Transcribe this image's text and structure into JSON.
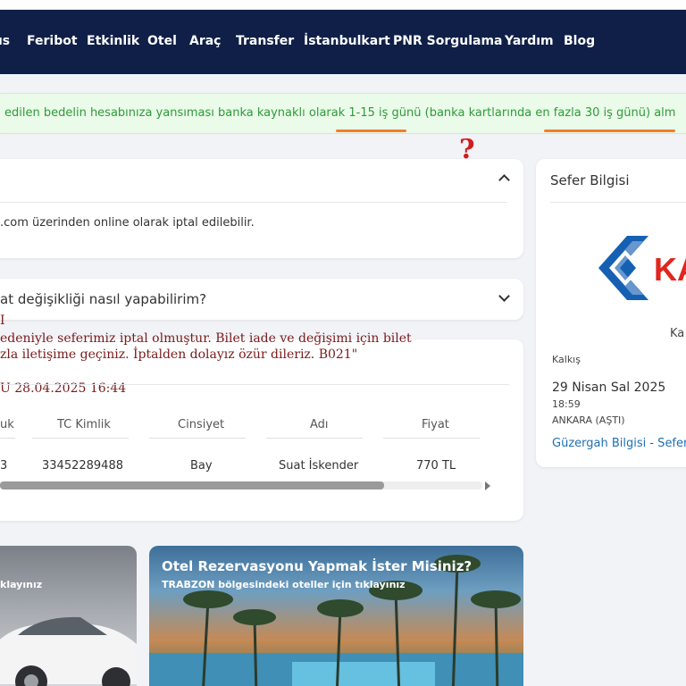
{
  "nav": {
    "items": [
      "ıs",
      "Feribot",
      "Etkinlik",
      "Otel",
      "Araç",
      "Transfer",
      "İstanbulkart",
      "PNR Sorgulama",
      "Yardım",
      "Blog"
    ]
  },
  "notice": {
    "text": "edilen bedelin hesabınıza yansıması banka kaynaklı olarak 1-15 iş günü (banka kartlarında en fazla 30 iş günü) alm"
  },
  "overlay": {
    "question_mark": "?"
  },
  "faq": {
    "card1_text": ".com üzerinden online olarak iptal edilebilir.",
    "card2_question": "at değişikliği nasıl yapabilirim?"
  },
  "cancel_message": {
    "line0": "I",
    "line1": "edeniyle seferimiz iptal olmuştur.  Bilet iade ve değişimi için bilet",
    "line2": "zla iletişime geçiniz.  İptalden dolayız özür dileriz.  B021\"",
    "line3": "U  28.04.2025 16:44"
  },
  "ticket_table": {
    "headers": [
      "uk",
      "TC Kimlik",
      "Cinsiyet",
      "Adı",
      "Fiyat"
    ],
    "row": [
      "3",
      "33452289488",
      "Bay",
      "Suat İskender",
      "770 TL"
    ]
  },
  "sidebar": {
    "title": "Sefer Bilgisi",
    "company_partial": "Ka",
    "departure_label": "Kalkış",
    "date": "29 Nisan Sal 2025",
    "time": "18:59",
    "station": "ANKARA (AŞTI)",
    "route_link": "Güzergah Bilgisi - Sefer"
  },
  "promos": {
    "car_subtitle": "klayınız",
    "hotel_title": "Otel Rezervasyonu Yapmak İster Misiniz?",
    "hotel_subtitle": "TRABZON bölgesindeki oteller için tıklayınız"
  },
  "colors": {
    "navbar": "#0f1f47",
    "notice_text": "#2f9a3a",
    "accent_underline": "#f07f2a",
    "link": "#1e6fb5",
    "logo_blue": "#1660b3",
    "logo_red": "#e0261f"
  }
}
